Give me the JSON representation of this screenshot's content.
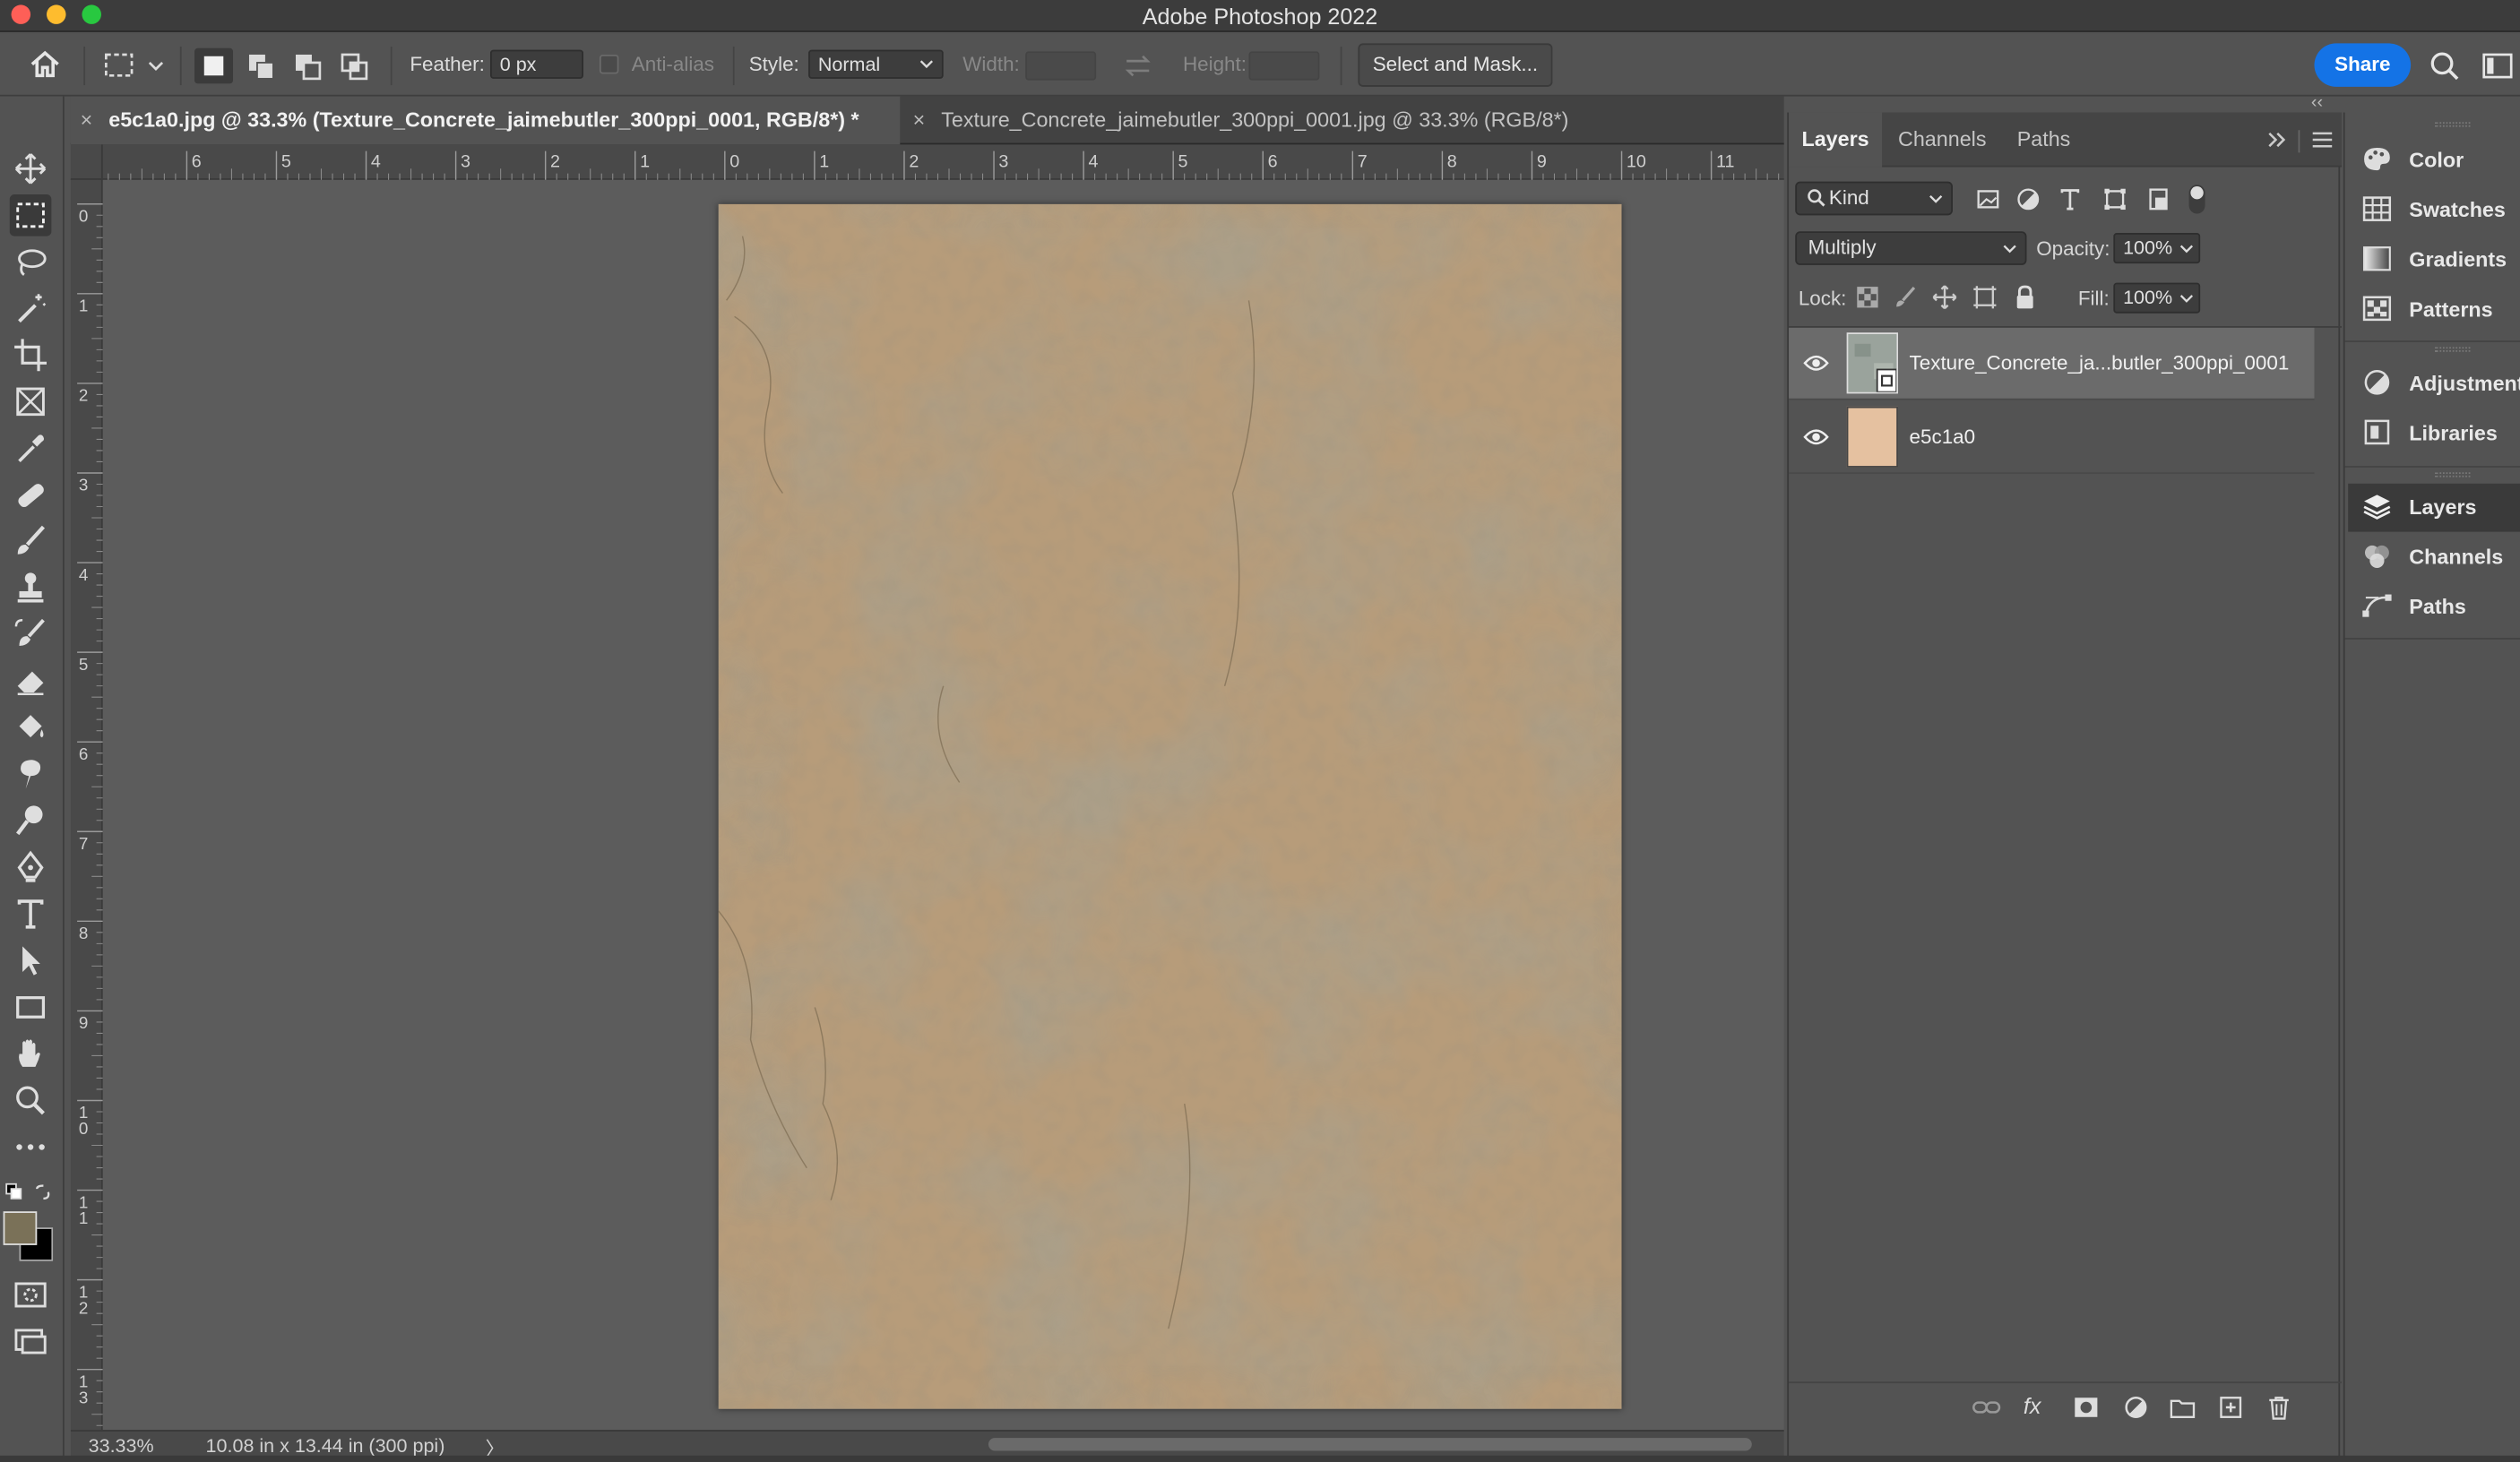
{
  "app_title": "Adobe Photoshop 2022",
  "options_bar": {
    "feather_label": "Feather:",
    "feather_value": "0 px",
    "anti_alias_label": "Anti-alias",
    "style_label": "Style:",
    "style_value": "Normal",
    "width_label": "Width:",
    "height_label": "Height:",
    "select_mask_label": "Select and Mask...",
    "share_label": "Share"
  },
  "tabs": [
    {
      "label": "e5c1a0.jpg @ 33.3% (Texture_Concrete_jaimebutler_300ppi_0001, RGB/8*) *",
      "active": true
    },
    {
      "label": "Texture_Concrete_jaimebutler_300ppi_0001.jpg @ 33.3% (RGB/8*)",
      "active": false
    }
  ],
  "rulers": {
    "horizontal": [
      "6",
      "5",
      "4",
      "3",
      "2",
      "1",
      "0",
      "1",
      "2",
      "3",
      "4",
      "5",
      "6",
      "7",
      "8",
      "9",
      "10",
      "11"
    ],
    "vertical": [
      "0",
      "1",
      "2",
      "3",
      "4",
      "5",
      "6",
      "7",
      "8",
      "9",
      "1\n0",
      "1\n1",
      "1\n2",
      "1\n3"
    ]
  },
  "status": {
    "zoom": "33.33%",
    "doc_info": "10.08 in x 13.44 in (300 ppi)",
    "arrow": "〉"
  },
  "layers_panel": {
    "tabs": [
      "Layers",
      "Channels",
      "Paths"
    ],
    "filter_kind": "Kind",
    "blend_mode": "Multiply",
    "opacity_label": "Opacity:",
    "opacity_value": "100%",
    "lock_label": "Lock:",
    "fill_label": "Fill:",
    "fill_value": "100%",
    "layers": [
      {
        "name": "Texture_Concrete_ja...butler_300ppi_0001",
        "visible": true,
        "selected": true
      },
      {
        "name": "e5c1a0",
        "visible": true,
        "selected": false
      }
    ],
    "base_layer_color": "#e5c1a0"
  },
  "right_dock": {
    "group1": [
      "Color",
      "Swatches",
      "Gradients",
      "Patterns"
    ],
    "group2": [
      "Adjustments",
      "Libraries"
    ],
    "group3": [
      "Layers",
      "Channels",
      "Paths"
    ]
  },
  "colors": {
    "accent": "#1473e6",
    "foreground_swatch": "#7a7158",
    "background_swatch": "#000000"
  }
}
